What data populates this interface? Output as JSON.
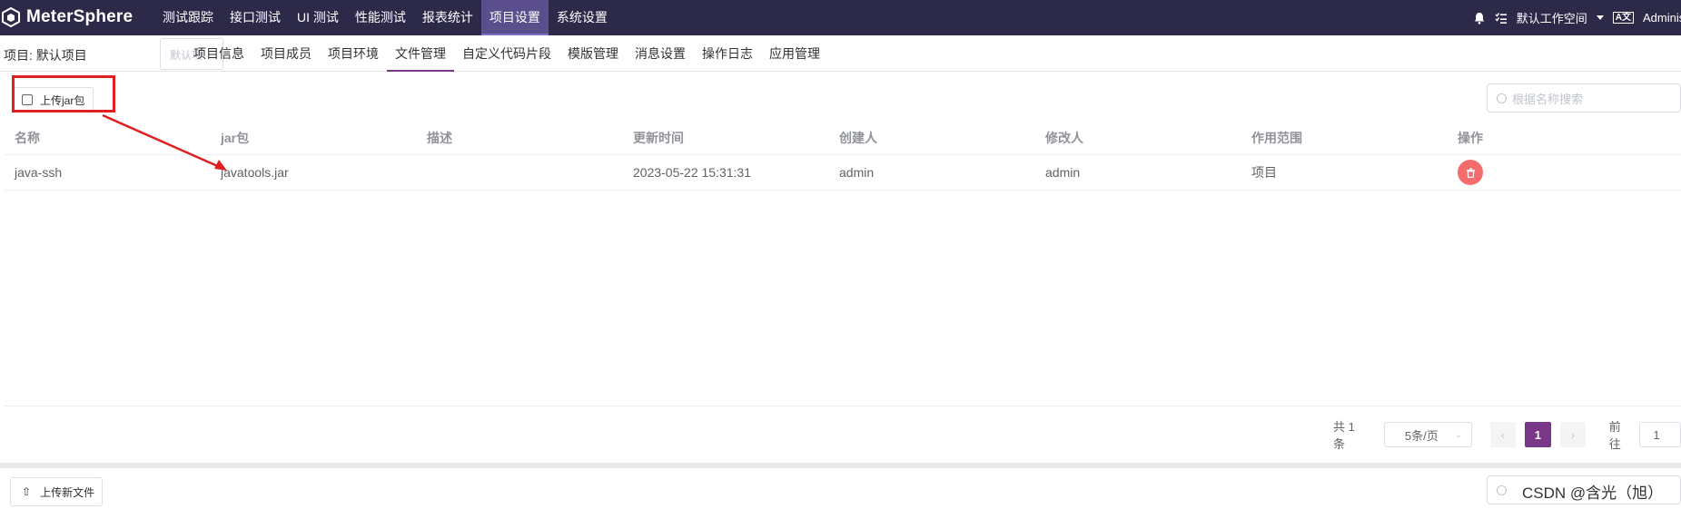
{
  "app": {
    "name": "MeterSphere"
  },
  "topnav": {
    "items": [
      "测试跟踪",
      "接口测试",
      "UI 测试",
      "性能测试",
      "报表统计",
      "项目设置",
      "系统设置"
    ],
    "active": "项目设置",
    "workspace": "默认工作空间",
    "user": "Administ"
  },
  "project": {
    "label": "项目: 默认项目",
    "select_value": "默认项"
  },
  "subnav": {
    "items": [
      "项目信息",
      "项目成员",
      "项目环境",
      "文件管理",
      "自定义代码片段",
      "模版管理",
      "消息设置",
      "操作日志",
      "应用管理"
    ],
    "active": "文件管理"
  },
  "toolbar": {
    "upload_jar": "上传jar包",
    "search_placeholder": "根据名称搜索"
  },
  "table": {
    "headers": [
      "名称",
      "jar包",
      "描述",
      "更新时间",
      "创建人",
      "修改人",
      "作用范围",
      "操作"
    ],
    "rows": [
      {
        "name": "java-ssh",
        "jar": "javatools.jar",
        "desc": "",
        "updated": "2023-05-22 15:31:31",
        "creator": "admin",
        "modifier": "admin",
        "scope": "项目"
      }
    ]
  },
  "pagination": {
    "total": "共 1 条",
    "page_size": "5条/页",
    "current": "1",
    "goto_label": "前往",
    "goto_value": "1"
  },
  "bottom": {
    "upload_file": "上传新文件",
    "search_placeholder": "根据名称搜索"
  },
  "watermark": "CSDN @含光（旭）",
  "colors": {
    "topbar": "#2c2a48",
    "accent": "#783887",
    "danger": "#f56c6c",
    "annotation": "#e02020"
  }
}
